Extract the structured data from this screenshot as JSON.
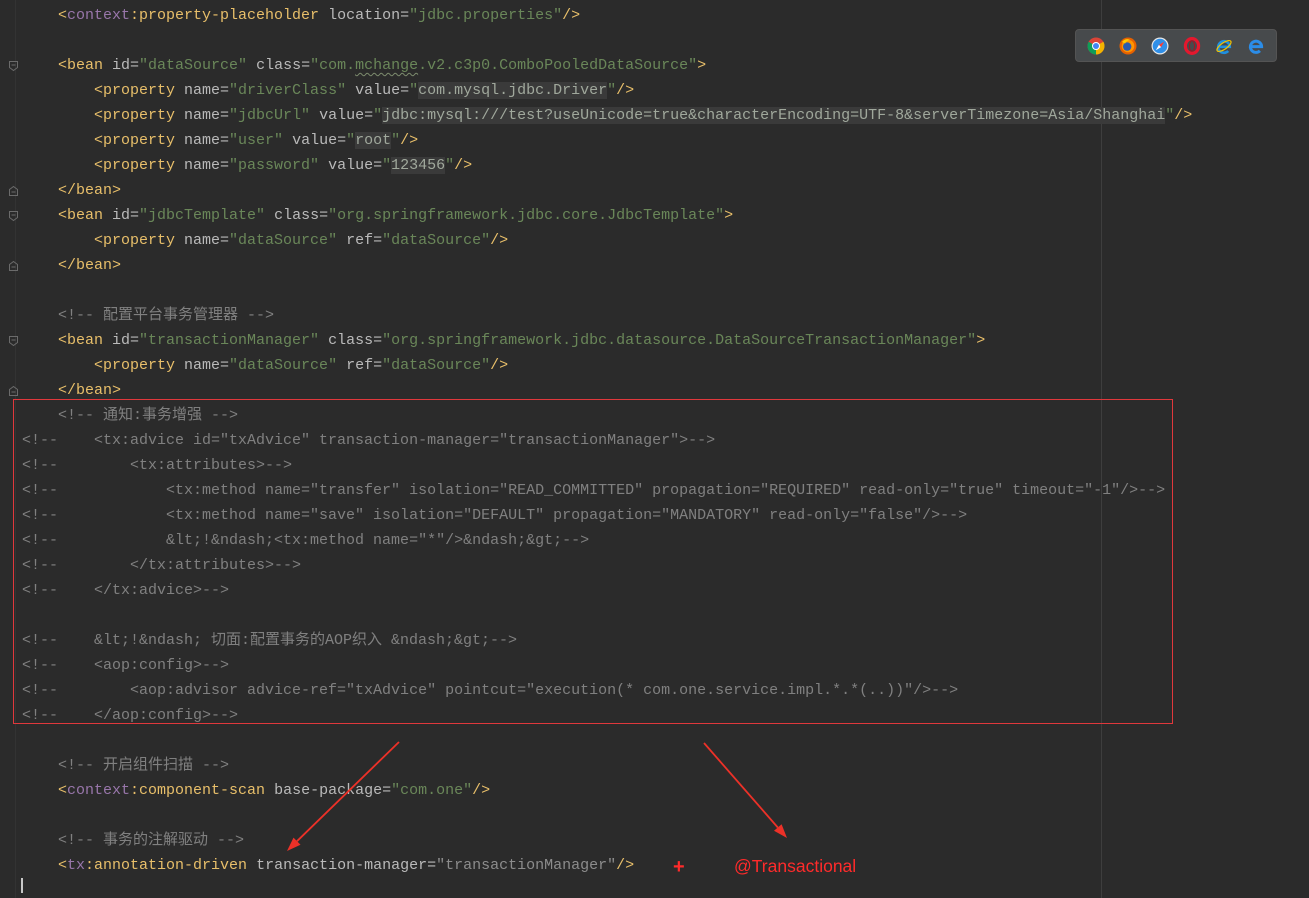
{
  "theme": {
    "editor_background": "#2b2b2b",
    "value_highlight_background": "#3a3a3a",
    "annotation_red": "#ff2b2b",
    "syntax": {
      "tag": "#e8bf6a",
      "ns": "#9876aa",
      "attr": "#bababa",
      "str": "#6a8759",
      "typo": "#6a8759",
      "hl": "#a0a89c",
      "dim": "#8c8c8c",
      "comment": "#808080"
    }
  },
  "browser_popup": {
    "icons": [
      "chrome-icon",
      "firefox-icon",
      "safari-icon",
      "opera-icon",
      "internet-explorer-icon",
      "edge-icon"
    ]
  },
  "code": {
    "lines": [
      [
        {
          "tag": "    <"
        },
        {
          "ns": "context"
        },
        {
          "tag": ":property-placeholder"
        },
        {
          "attr": " location="
        },
        {
          "str": "\"jdbc.properties\""
        },
        {
          "tag": "/>"
        }
      ],
      [],
      [
        {
          "tag": "    <bean"
        },
        {
          "attr": " id="
        },
        {
          "str": "\"dataSource\""
        },
        {
          "attr": " class="
        },
        {
          "str": "\"com."
        },
        {
          "typo": "mchange"
        },
        {
          "str": ".v2.c3p0.ComboPooledDataSource\""
        },
        {
          "tag": ">"
        }
      ],
      [
        {
          "tag": "        <property"
        },
        {
          "attr": " name="
        },
        {
          "str": "\"driverClass\""
        },
        {
          "attr": " value="
        },
        {
          "str": "\""
        },
        {
          "hl": "com.mysql.jdbc.Driver"
        },
        {
          "str": "\""
        },
        {
          "tag": "/>"
        }
      ],
      [
        {
          "tag": "        <property"
        },
        {
          "attr": " name="
        },
        {
          "str": "\"jdbcUrl\""
        },
        {
          "attr": " value="
        },
        {
          "str": "\""
        },
        {
          "hl": "jdbc:mysql:///test?useUnicode=true&characterEncoding=UTF-8&serverTimezone=Asia/Shanghai"
        },
        {
          "str": "\""
        },
        {
          "tag": "/>"
        }
      ],
      [
        {
          "tag": "        <property"
        },
        {
          "attr": " name="
        },
        {
          "str": "\"user\""
        },
        {
          "attr": " value="
        },
        {
          "str": "\""
        },
        {
          "hl": "root"
        },
        {
          "str": "\""
        },
        {
          "tag": "/>"
        }
      ],
      [
        {
          "tag": "        <property"
        },
        {
          "attr": " name="
        },
        {
          "str": "\"password\""
        },
        {
          "attr": " value="
        },
        {
          "str": "\""
        },
        {
          "hl": "123456"
        },
        {
          "str": "\""
        },
        {
          "tag": "/>"
        }
      ],
      [
        {
          "tag": "    </bean>"
        }
      ],
      [
        {
          "tag": "    <bean"
        },
        {
          "attr": " id="
        },
        {
          "str": "\"jdbcTemplate\""
        },
        {
          "attr": " class="
        },
        {
          "str": "\"org.springframework.jdbc.core.JdbcTemplate\""
        },
        {
          "tag": ">"
        }
      ],
      [
        {
          "tag": "        <property"
        },
        {
          "attr": " name="
        },
        {
          "str": "\"dataSource\""
        },
        {
          "attr": " ref="
        },
        {
          "str": "\"dataSource\""
        },
        {
          "tag": "/>"
        }
      ],
      [
        {
          "tag": "    </bean>"
        }
      ],
      [],
      [
        {
          "comment": "    <!-- 配置平台事务管理器 -->"
        }
      ],
      [
        {
          "tag": "    <bean"
        },
        {
          "attr": " id="
        },
        {
          "str": "\"transactionManager\""
        },
        {
          "attr": " class="
        },
        {
          "str": "\"org.springframework.jdbc.datasource.DataSourceTransactionManager\""
        },
        {
          "tag": ">"
        }
      ],
      [
        {
          "tag": "        <property"
        },
        {
          "attr": " name="
        },
        {
          "str": "\"dataSource\""
        },
        {
          "attr": " ref="
        },
        {
          "str": "\"dataSource\""
        },
        {
          "tag": "/>"
        }
      ],
      [
        {
          "tag": "    </bean>"
        }
      ],
      [
        {
          "comment": "    <!-- 通知:事务增强 -->"
        }
      ],
      [
        {
          "comment": "<!--    <tx:advice id=\"txAdvice\" transaction-manager=\"transactionManager\">-->"
        }
      ],
      [
        {
          "comment": "<!--        <tx:attributes>-->"
        }
      ],
      [
        {
          "comment": "<!--            <tx:method name=\"transfer\" isolation=\"READ_COMMITTED\" propagation=\"REQUIRED\" read-only=\"true\" timeout=\"-1\"/>-->"
        }
      ],
      [
        {
          "comment": "<!--            <tx:method name=\"save\" isolation=\"DEFAULT\" propagation=\"MANDATORY\" read-only=\"false\"/>-->"
        }
      ],
      [
        {
          "comment": "<!--            &lt;!&ndash;<tx:method name=\"*\"/>&ndash;&gt;-->"
        }
      ],
      [
        {
          "comment": "<!--        </tx:attributes>-->"
        }
      ],
      [
        {
          "comment": "<!--    </tx:advice>-->"
        }
      ],
      [],
      [
        {
          "comment": "<!--    &lt;!&ndash; 切面:配置事务的AOP织入 &ndash;&gt;-->"
        }
      ],
      [
        {
          "comment": "<!--    <aop:config>-->"
        }
      ],
      [
        {
          "comment": "<!--        <aop:advisor advice-ref=\"txAdvice\" pointcut=\"execution(* com.one.service.impl.*.*(..))\"/>-->"
        }
      ],
      [
        {
          "comment": "<!--    </aop:config>-->"
        }
      ],
      [],
      [
        {
          "comment": "    <!-- 开启组件扫描 -->"
        }
      ],
      [
        {
          "tag": "    <"
        },
        {
          "ns": "context"
        },
        {
          "tag": ":component-scan"
        },
        {
          "attr": " base-package="
        },
        {
          "str": "\"com.one\""
        },
        {
          "tag": "/>"
        }
      ],
      [],
      [
        {
          "comment": "    <!-- 事务的注解驱动 -->"
        }
      ],
      [
        {
          "tag": "    <"
        },
        {
          "ns": "tx"
        },
        {
          "tag": ":annotation-driven"
        },
        {
          "attr": " transaction-manager="
        },
        {
          "dim": "\"transactionManager\""
        },
        {
          "tag": "/>"
        }
      ]
    ]
  },
  "annotations": {
    "plus": "+",
    "label": "@Transactional"
  }
}
